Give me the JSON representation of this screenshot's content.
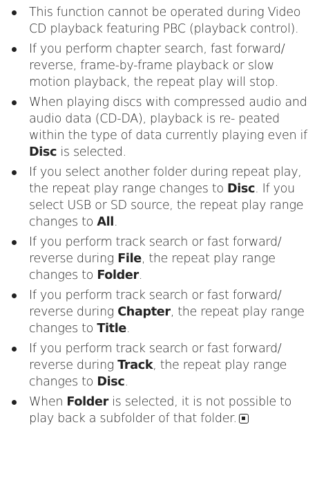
{
  "notes": [
    {
      "segments": [
        {
          "text": "This function cannot be operated during Video CD playback featuring PBC (playback control).",
          "bold": false
        }
      ]
    },
    {
      "segments": [
        {
          "text": "If you perform chapter search, fast forward/ reverse, frame-by-frame playback or slow motion playback, the repeat play will stop.",
          "bold": false
        }
      ]
    },
    {
      "segments": [
        {
          "text": "When playing discs with compressed audio and audio data (CD-DA), playback is re- peated within the type of data currently playing even if ",
          "bold": false
        },
        {
          "text": "Disc",
          "bold": true
        },
        {
          "text": " is selected.",
          "bold": false
        }
      ]
    },
    {
      "segments": [
        {
          "text": "If you select another folder during repeat play, the repeat play range changes to ",
          "bold": false
        },
        {
          "text": "Disc",
          "bold": true
        },
        {
          "text": ". If you select USB or SD source, the repeat play range changes to ",
          "bold": false
        },
        {
          "text": "All",
          "bold": true
        },
        {
          "text": ".",
          "bold": false
        }
      ]
    },
    {
      "segments": [
        {
          "text": "If you perform track search or fast forward/ reverse during ",
          "bold": false
        },
        {
          "text": "File",
          "bold": true
        },
        {
          "text": ", the repeat play range changes to ",
          "bold": false
        },
        {
          "text": "Folder",
          "bold": true
        },
        {
          "text": ".",
          "bold": false
        }
      ]
    },
    {
      "segments": [
        {
          "text": "If you perform track search or fast forward/ reverse during ",
          "bold": false
        },
        {
          "text": "Chapter",
          "bold": true
        },
        {
          "text": ", the repeat play range changes to ",
          "bold": false
        },
        {
          "text": "Title",
          "bold": true
        },
        {
          "text": ".",
          "bold": false
        }
      ]
    },
    {
      "segments": [
        {
          "text": "If you perform track search or fast forward/ reverse during ",
          "bold": false
        },
        {
          "text": "Track",
          "bold": true
        },
        {
          "text": ", the repeat play range changes to ",
          "bold": false
        },
        {
          "text": "Disc",
          "bold": true
        },
        {
          "text": ".",
          "bold": false
        }
      ]
    },
    {
      "segments": [
        {
          "text": "When ",
          "bold": false
        },
        {
          "text": "Folder",
          "bold": true
        },
        {
          "text": " is selected, it is not possible to play back a subfolder of that folder.",
          "bold": false
        }
      ],
      "end_mark": "end-of-section-icon"
    }
  ]
}
